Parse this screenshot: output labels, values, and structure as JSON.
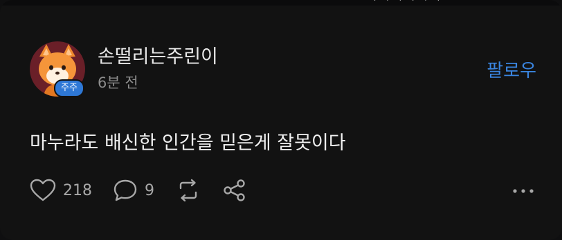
{
  "post": {
    "author": {
      "name": "손떨리는주린이",
      "badge": "주주",
      "avatar_icon": "fox-avatar-icon"
    },
    "time": "6분 전",
    "follow_label": "팔로우",
    "text": "마누라도 배신한 인간을 믿은게 잘못이다",
    "actions": {
      "likes": "218",
      "comments": "9"
    }
  },
  "colors": {
    "background": "#121212",
    "accent": "#3a85e0",
    "badge": "#2e78d6",
    "avatar_bg": "#6a1f28"
  }
}
